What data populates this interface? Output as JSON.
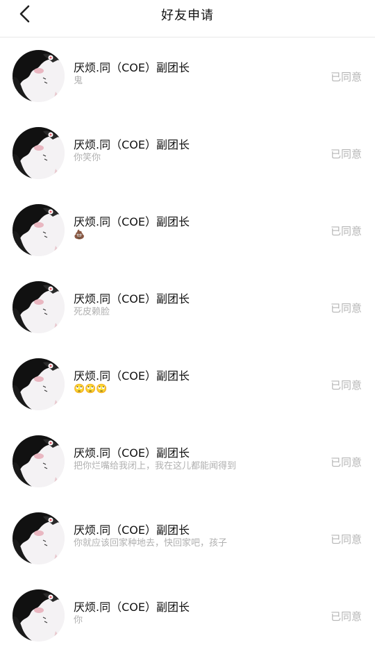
{
  "header": {
    "title": "好友申请",
    "back_icon": "chevron-left-icon"
  },
  "requests": [
    {
      "name": "厌烦.同（COE）副团长",
      "message": "鬼",
      "status": "已同意"
    },
    {
      "name": "厌烦.同（COE）副团长",
      "message": "你笑你",
      "status": "已同意"
    },
    {
      "name": "厌烦.同（COE）副团长",
      "message": "💩",
      "status": "已同意"
    },
    {
      "name": "厌烦.同（COE）副团长",
      "message": "死皮赖脸",
      "status": "已同意"
    },
    {
      "name": "厌烦.同（COE）副团长",
      "message": "🙄🙄🙄",
      "status": "已同意"
    },
    {
      "name": "厌烦.同（COE）副团长",
      "message": "把你烂嘴给我闭上，我在这儿都能闻得到",
      "status": "已同意"
    },
    {
      "name": "厌烦.同（COE）副团长",
      "message": "你就应该回家种地去，快回家吧，孩子",
      "status": "已同意"
    },
    {
      "name": "厌烦.同（COE）副团长",
      "message": "你",
      "status": "已同意"
    }
  ]
}
